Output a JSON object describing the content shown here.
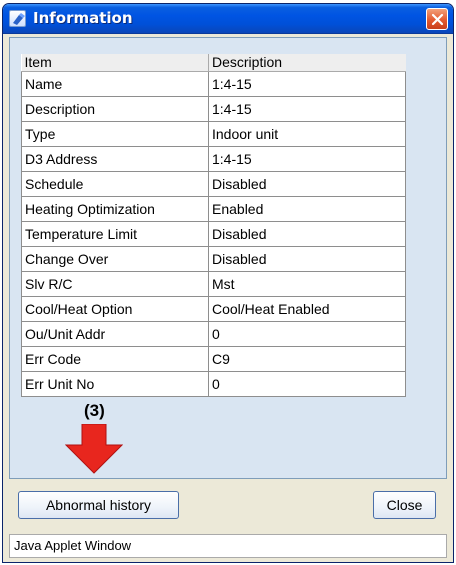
{
  "window": {
    "title": "Information",
    "close_icon": "close-icon"
  },
  "table": {
    "headers": [
      "Item",
      "Description"
    ],
    "rows": [
      [
        "Name",
        "1:4-15"
      ],
      [
        "Description",
        "1:4-15"
      ],
      [
        "Type",
        "Indoor unit"
      ],
      [
        "D3 Address",
        "1:4-15"
      ],
      [
        "Schedule",
        "Disabled"
      ],
      [
        "Heating Optimization",
        "Enabled"
      ],
      [
        "Temperature Limit",
        "Disabled"
      ],
      [
        "Change Over",
        "Disabled"
      ],
      [
        "Slv R/C",
        "Mst"
      ],
      [
        "Cool/Heat Option",
        "Cool/Heat Enabled"
      ],
      [
        "Ou/Unit Addr",
        "0"
      ],
      [
        "Err Code",
        "C9"
      ],
      [
        "Err Unit No",
        "0"
      ]
    ]
  },
  "annotation": {
    "label": "(3)",
    "arrow_color": "#e8261e"
  },
  "buttons": {
    "abnormal_history": "Abnormal history",
    "close": "Close"
  },
  "statusbar": {
    "text": "Java Applet Window"
  }
}
